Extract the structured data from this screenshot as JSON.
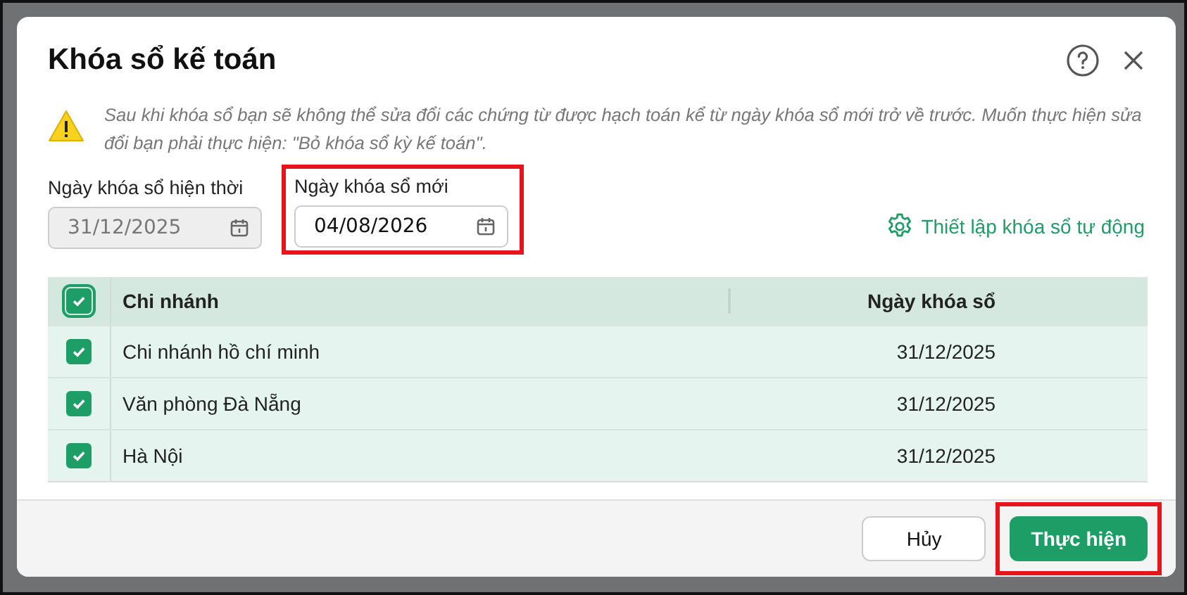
{
  "dialog": {
    "title": "Khóa sổ kế toán",
    "warning": "Sau khi khóa sổ bạn sẽ không thể sửa đổi các chứng từ được hạch toán kể từ ngày khóa sổ mới trở về trước. Muốn thực hiện sửa đổi bạn phải thực hiện: \"Bỏ khóa sổ kỳ kế toán\".",
    "fields": [
      {
        "label": "Ngày khóa sổ hiện thời",
        "value": "31/12/2025",
        "disabled": true,
        "highlighted": false
      },
      {
        "label": "Ngày khóa sổ mới",
        "value": "04/08/2026",
        "disabled": false,
        "highlighted": true
      }
    ],
    "auto_link": "Thiết lập khóa sổ tự động",
    "table": {
      "all_checked": true,
      "columns": [
        "Chi nhánh",
        "Ngày khóa sổ"
      ],
      "rows": [
        {
          "checked": true,
          "cells": [
            "Chi nhánh hồ chí minh",
            "31/12/2025"
          ]
        },
        {
          "checked": true,
          "cells": [
            "Văn phòng Đà Nẵng",
            "31/12/2025"
          ]
        },
        {
          "checked": true,
          "cells": [
            "Hà Nội",
            "31/12/2025"
          ]
        }
      ]
    },
    "buttons": [
      {
        "label": "Hủy",
        "kind": "secondary",
        "highlighted": false
      },
      {
        "label": "Thực hiện",
        "kind": "primary",
        "highlighted": true
      }
    ]
  }
}
